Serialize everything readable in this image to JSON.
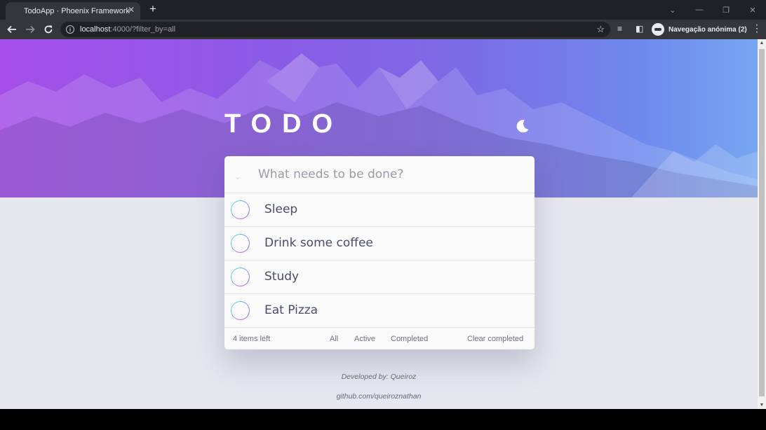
{
  "browser": {
    "tab_title": "TodoApp · Phoenix Framework",
    "tab_close": "✕",
    "new_tab": "+",
    "url_host": "localhost",
    "url_rest": ":4000/?filter_by=all",
    "profile_label": "Navegação anónima (2)"
  },
  "app": {
    "title": "TODO",
    "new_todo_placeholder": "What needs to be done?",
    "todos": [
      {
        "label": "Sleep",
        "completed": false
      },
      {
        "label": "Drink some coffee",
        "completed": false
      },
      {
        "label": "Study",
        "completed": false
      },
      {
        "label": "Eat Pizza",
        "completed": false
      }
    ],
    "footer": {
      "items_left": "4 items left",
      "filter_all": "All",
      "filter_active": "Active",
      "filter_completed": "Completed",
      "clear_completed": "Clear completed"
    },
    "credits": {
      "developer": "Developed by: Queiroz",
      "github": "github.com/queiroznathan"
    }
  },
  "colors": {
    "gradient_start": "#55ddff",
    "gradient_end": "#c058f3",
    "text": "#494c6b"
  }
}
